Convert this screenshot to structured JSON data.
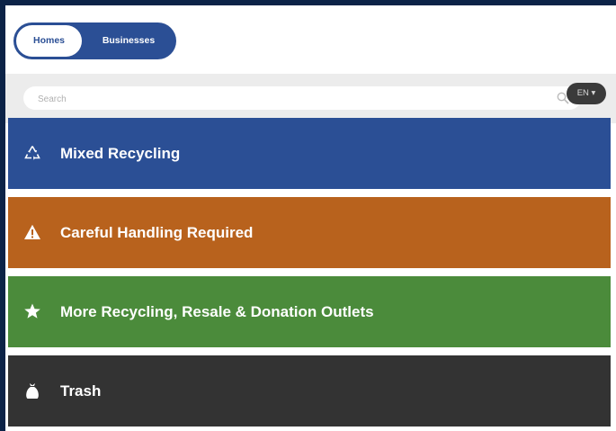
{
  "toggle": {
    "homes_label": "Homes",
    "businesses_label": "Businesses",
    "selected": "Homes"
  },
  "search": {
    "placeholder": "Search",
    "value": ""
  },
  "language": {
    "label": "EN ▾"
  },
  "categories": [
    {
      "label": "Mixed Recycling",
      "icon": "recycle-icon",
      "color": "#2b4f95"
    },
    {
      "label": "Careful Handling Required",
      "icon": "warning-icon",
      "color": "#b8621d"
    },
    {
      "label": "More Recycling, Resale & Donation Outlets",
      "icon": "star-icon",
      "color": "#4b8b3b"
    },
    {
      "label": "Trash",
      "icon": "trash-bag-icon",
      "color": "#333333"
    }
  ],
  "colors": {
    "page_border": "#0c2347",
    "accent": "#2b4f95"
  }
}
